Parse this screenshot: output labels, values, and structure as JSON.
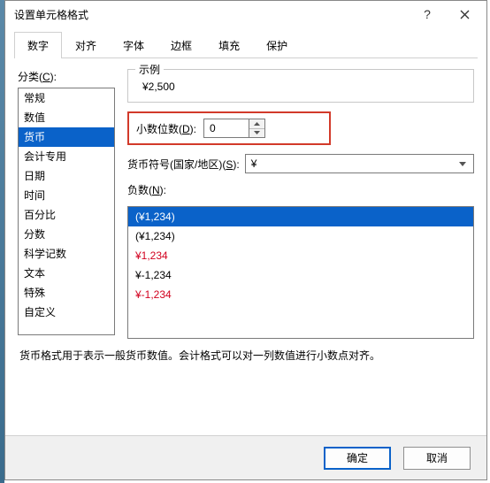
{
  "title": "设置单元格格式",
  "tabs": [
    "数字",
    "对齐",
    "字体",
    "边框",
    "填充",
    "保护"
  ],
  "active_tab_index": 0,
  "category": {
    "label_pre": "分类(",
    "label_u": "C",
    "label_post": "):",
    "items": [
      "常规",
      "数值",
      "货币",
      "会计专用",
      "日期",
      "时间",
      "百分比",
      "分数",
      "科学记数",
      "文本",
      "特殊",
      "自定义"
    ],
    "selected_index": 2
  },
  "sample": {
    "label": "示例",
    "value": "¥2,500"
  },
  "decimals": {
    "label_pre": "小数位数(",
    "label_u": "D",
    "label_post": "):",
    "value": "0"
  },
  "symbol": {
    "label_pre": "货币符号(国家/地区)(",
    "label_u": "S",
    "label_post": "):",
    "value": "¥"
  },
  "negative": {
    "label_pre": "负数(",
    "label_u": "N",
    "label_post": "):",
    "items": [
      {
        "text": "(¥1,234)",
        "style": "red",
        "selected": true
      },
      {
        "text": "(¥1,234)",
        "style": "black",
        "selected": false
      },
      {
        "text": "¥1,234",
        "style": "red",
        "selected": false
      },
      {
        "text": "¥-1,234",
        "style": "black",
        "selected": false
      },
      {
        "text": "¥-1,234",
        "style": "red",
        "selected": false
      }
    ]
  },
  "description": "货币格式用于表示一般货币数值。会计格式可以对一列数值进行小数点对齐。",
  "buttons": {
    "ok": "确定",
    "cancel": "取消"
  }
}
